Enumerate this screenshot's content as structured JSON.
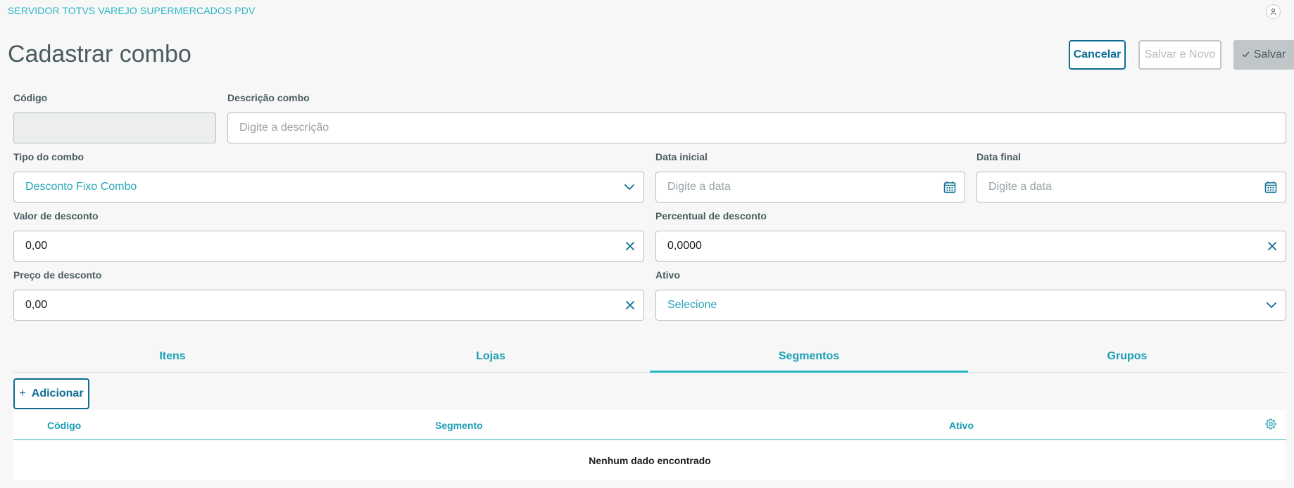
{
  "app": {
    "title": "SERVIDOR TOTVS VAREJO SUPERMERCADOS PDV",
    "avatar_icon": "user-icon"
  },
  "page": {
    "title": "Cadastrar combo"
  },
  "actions": {
    "cancel_label": "Cancelar",
    "save_new_label": "Salvar e Novo",
    "save_label": "Salvar"
  },
  "form": {
    "codigo": {
      "label": "Código",
      "value": ""
    },
    "descricao": {
      "label": "Descrição combo",
      "placeholder": "Digite a descrição"
    },
    "tipo": {
      "label": "Tipo do combo",
      "value": "Desconto Fixo Combo"
    },
    "data_inicial": {
      "label": "Data inicial",
      "placeholder": "Digite a data"
    },
    "data_final": {
      "label": "Data final",
      "placeholder": "Digite a data"
    },
    "valor_desconto": {
      "label": "Valor de desconto",
      "value": "0,00"
    },
    "percentual_desconto": {
      "label": "Percentual de desconto",
      "value": "0,0000"
    },
    "preco_desconto": {
      "label": "Preço de desconto",
      "value": "0,00"
    },
    "ativo": {
      "label": "Ativo",
      "value": "Selecione"
    }
  },
  "tabs": [
    {
      "label": "Itens",
      "active": false
    },
    {
      "label": "Lojas",
      "active": false
    },
    {
      "label": "Segmentos",
      "active": true
    },
    {
      "label": "Grupos",
      "active": false
    }
  ],
  "add_button": {
    "icon": "+",
    "label": "Adicionar"
  },
  "table": {
    "columns": [
      "Código",
      "Segmento",
      "Ativo"
    ],
    "empty_message": "Nenhum dado encontrado"
  },
  "colors": {
    "primary": "#0c6c94",
    "accent": "#29b6c5",
    "text": "#4a5c60",
    "disabled": "#c1c6c8"
  }
}
